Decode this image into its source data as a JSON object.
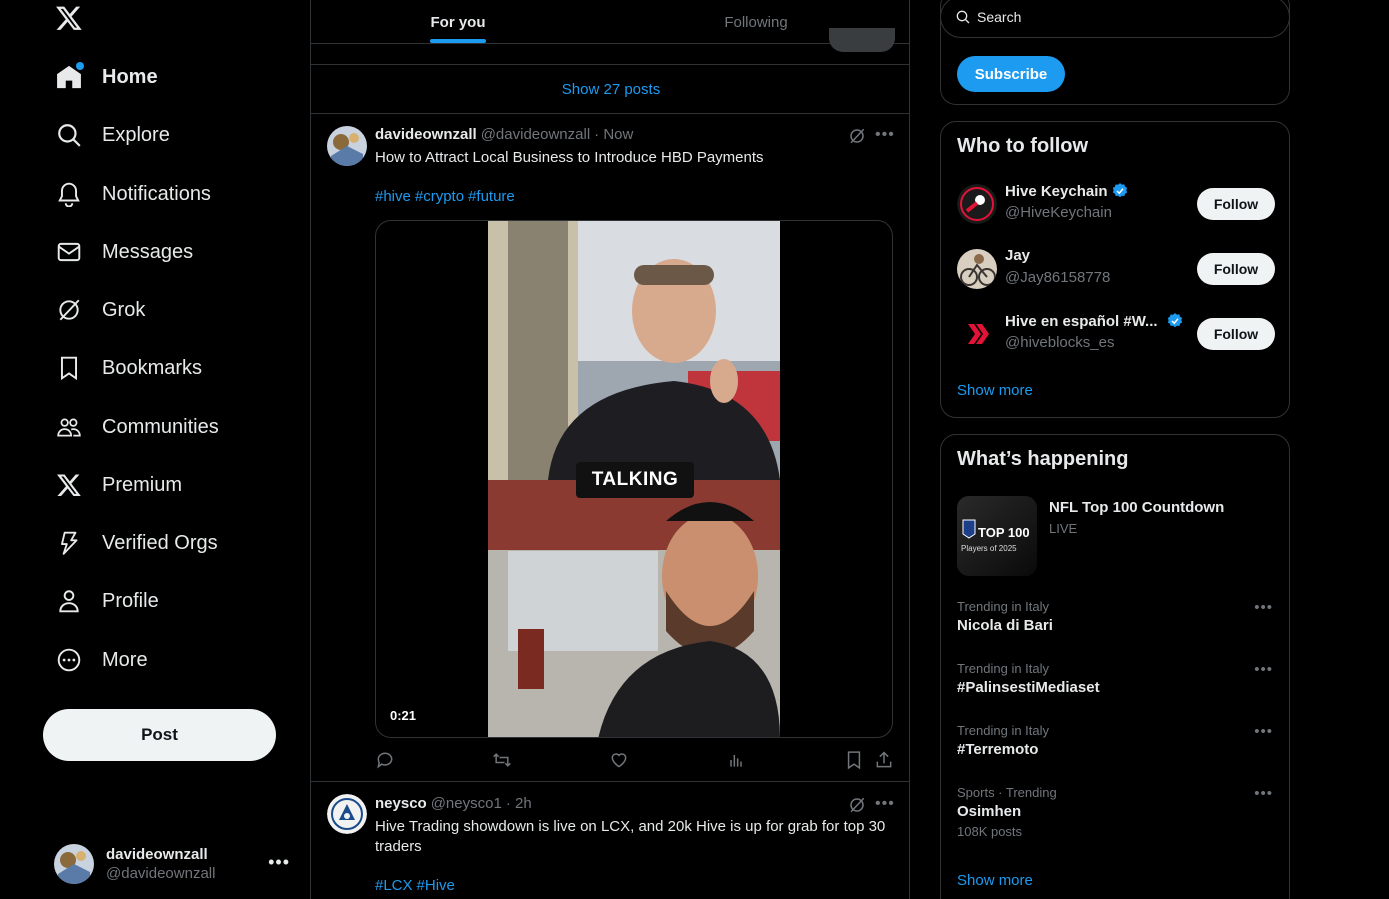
{
  "nav": {
    "items": [
      {
        "label": "Home",
        "icon": "home-icon"
      },
      {
        "label": "Explore",
        "icon": "search-icon"
      },
      {
        "label": "Notifications",
        "icon": "bell-icon"
      },
      {
        "label": "Messages",
        "icon": "envelope-icon"
      },
      {
        "label": "Grok",
        "icon": "grok-icon"
      },
      {
        "label": "Bookmarks",
        "icon": "bookmark-icon"
      },
      {
        "label": "Communities",
        "icon": "communities-icon"
      },
      {
        "label": "Premium",
        "icon": "x-logo-icon"
      },
      {
        "label": "Verified Orgs",
        "icon": "lightning-icon"
      },
      {
        "label": "Profile",
        "icon": "person-icon"
      },
      {
        "label": "More",
        "icon": "more-circle-icon"
      }
    ],
    "post_label": "Post"
  },
  "account": {
    "name": "davideownzall",
    "handle": "@davideownzall"
  },
  "feed": {
    "tabs": [
      {
        "label": "For you"
      },
      {
        "label": "Following"
      }
    ],
    "show_posts": "Show 27 posts",
    "tweets": [
      {
        "name": "davideownzall",
        "handle": "@davideownzall",
        "time": "· Now",
        "text": "How to Attract Local Business to Introduce HBD Payments",
        "tags": [
          "#hive",
          "#crypto",
          "#future"
        ],
        "video_duration": "0:21",
        "video_caption": "TALKING"
      },
      {
        "name": "neysco",
        "handle": "@neysco1",
        "time": "· 2h",
        "text": "Hive Trading showdown is live on LCX, and 20k Hive is up for grab for top 30 traders",
        "tags": [
          "#LCX",
          "#Hive"
        ]
      }
    ]
  },
  "right": {
    "search_placeholder": "Search",
    "subscribe_label": "Subscribe",
    "who_to_follow": {
      "title": "Who to follow",
      "accounts": [
        {
          "name": "Hive Keychain",
          "handle": "@HiveKeychain",
          "verified": true,
          "button": "Follow"
        },
        {
          "name": "Jay",
          "handle": "@Jay86158778",
          "verified": false,
          "button": "Follow"
        },
        {
          "name": "Hive en español #W...",
          "handle": "@hiveblocks_es",
          "verified": true,
          "button": "Follow"
        }
      ],
      "show_more": "Show more"
    },
    "whats_happening": {
      "title": "What’s happening",
      "featured": {
        "title": "NFL Top 100 Countdown",
        "status": "LIVE",
        "image_text": "TOP 100",
        "image_sub": "Players of 2025"
      },
      "trends": [
        {
          "meta": "Trending in Italy",
          "title": "Nicola di Bari",
          "count": ""
        },
        {
          "meta": "Trending in Italy",
          "title": "#PalinsestiMediaset",
          "count": ""
        },
        {
          "meta": "Trending in Italy",
          "title": "#Terremoto",
          "count": ""
        },
        {
          "meta": "Sports · Trending",
          "title": "Osimhen",
          "count": "108K posts"
        }
      ],
      "show_more": "Show more"
    }
  },
  "colors": {
    "accent": "#1d9bf0",
    "background": "#000000",
    "border": "#2f3336",
    "muted": "#71767b"
  }
}
